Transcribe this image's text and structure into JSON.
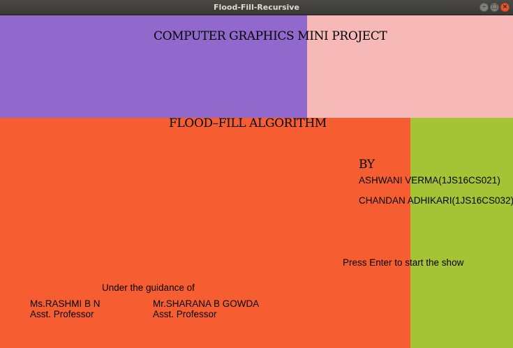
{
  "window": {
    "title": "Flood-Fill-Recursive",
    "controls": {
      "minimize": "–",
      "maximize": "□",
      "close": "×"
    }
  },
  "fill_colors": {
    "top_left": "#9168cc",
    "top_right": "#f7b8b8",
    "bottom_left": "#f65e31",
    "bottom_right": "#a6c336"
  },
  "content": {
    "heading": "COMPUTER GRAPHICS MINI PROJECT",
    "subheading": "FLOOD–FILL ALGORITHM",
    "by_label": "BY",
    "authors": [
      "ASHWANI VERMA(1JS16CS021)",
      "CHANDAN ADHIKARI(1JS16CS032)"
    ],
    "prompt": "Press Enter to start the show",
    "guidance_label": "Under the guidance of",
    "guides": [
      {
        "name": "Ms.RASHMI B N",
        "role": "Asst. Professor"
      },
      {
        "name": "Mr.SHARANA B GOWDA",
        "role": "Asst. Professor"
      }
    ]
  }
}
